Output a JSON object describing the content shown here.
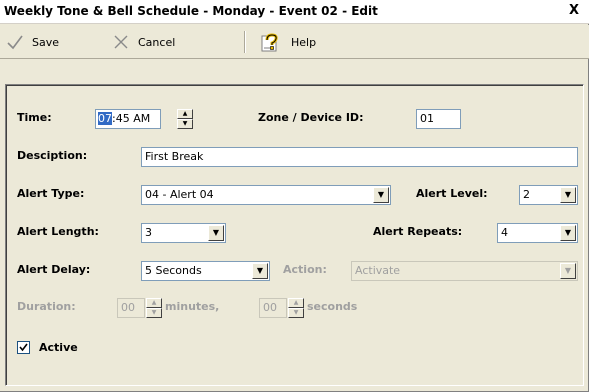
{
  "window": {
    "title": "Weekly Tone & Bell Schedule - Monday - Event 02 - Edit",
    "close_glyph": "X"
  },
  "toolbar": {
    "save_label": "Save",
    "cancel_label": "Cancel",
    "help_label": "Help"
  },
  "form": {
    "time": {
      "label": "Time:",
      "hour": "07",
      "rest": ":45 AM"
    },
    "zone": {
      "label": "Zone / Device ID:",
      "value": "01"
    },
    "description": {
      "label": "Desciption:",
      "value": "First Break"
    },
    "alert_type": {
      "label": "Alert Type:",
      "value": "04 - Alert 04"
    },
    "alert_level": {
      "label": "Alert Level:",
      "value": "2"
    },
    "alert_length": {
      "label": "Alert Length:",
      "value": "3"
    },
    "alert_repeats": {
      "label": "Alert Repeats:",
      "value": "4"
    },
    "alert_delay": {
      "label": "Alert Delay:",
      "value": "5 Seconds"
    },
    "action": {
      "label": "Action:",
      "value": "Activate"
    },
    "duration": {
      "label": "Duration:",
      "minutes_value": "00",
      "minutes_label": "minutes,",
      "seconds_value": "00",
      "seconds_label": "seconds"
    },
    "active": {
      "label": "Active",
      "checked": true
    }
  }
}
